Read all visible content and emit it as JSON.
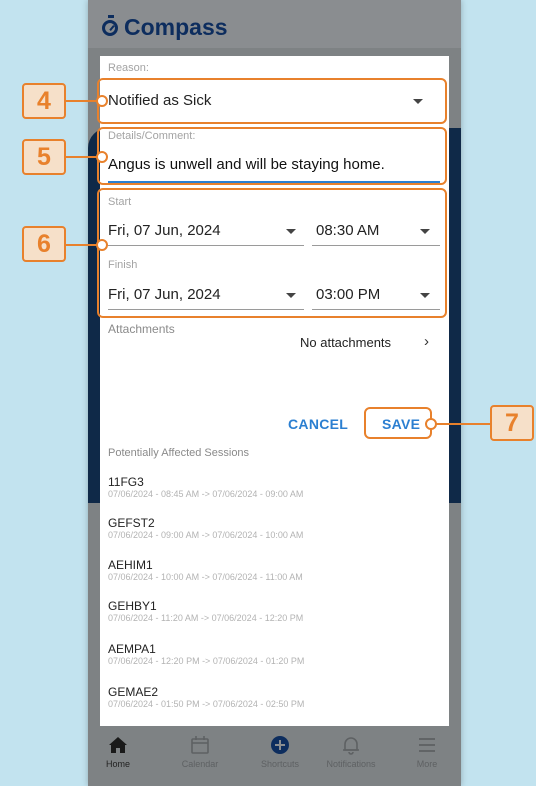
{
  "app": {
    "name": "Compass"
  },
  "form": {
    "reason": {
      "label": "Reason:",
      "value": "Notified as Sick"
    },
    "details": {
      "label": "Details/Comment:",
      "value": "Angus is unwell and will be staying home."
    },
    "start": {
      "label": "Start",
      "date": "Fri, 07 Jun, 2024",
      "time": "08:30 AM"
    },
    "finish": {
      "label": "Finish",
      "date": "Fri, 07 Jun, 2024",
      "time": "03:00 PM"
    },
    "attachments": {
      "label": "Attachments",
      "value": "No attachments"
    },
    "cancel_label": "CANCEL",
    "save_label": "SAVE"
  },
  "sessions": {
    "heading": "Potentially Affected Sessions",
    "items": [
      {
        "code": "11FG3",
        "time": "07/06/2024 - 08:45 AM -> 07/06/2024 - 09:00 AM"
      },
      {
        "code": "GEFST2",
        "time": "07/06/2024 - 09:00 AM -> 07/06/2024 - 10:00 AM"
      },
      {
        "code": "AEHIM1",
        "time": "07/06/2024 - 10:00 AM -> 07/06/2024 - 11:00 AM"
      },
      {
        "code": "GEHBY1",
        "time": "07/06/2024 - 11:20 AM -> 07/06/2024 - 12:20 PM"
      },
      {
        "code": "AEMPA1",
        "time": "07/06/2024 - 12:20 PM -> 07/06/2024 - 01:20 PM"
      },
      {
        "code": "GEMAE2",
        "time": "07/06/2024 - 01:50 PM -> 07/06/2024 - 02:50 PM"
      }
    ]
  },
  "nav": {
    "items": [
      {
        "label": "Home",
        "icon": "home-icon"
      },
      {
        "label": "Calendar",
        "icon": "calendar-icon"
      },
      {
        "label": "Shortcuts",
        "icon": "plus-circle-icon"
      },
      {
        "label": "Notifications",
        "icon": "bell-icon"
      },
      {
        "label": "More",
        "icon": "menu-icon"
      }
    ]
  },
  "annotations": {
    "n4": "4",
    "n5": "5",
    "n6": "6",
    "n7": "7"
  },
  "colors": {
    "accent": "#e8812c",
    "link": "#2b7fd1",
    "brand": "#0d2d5e"
  }
}
